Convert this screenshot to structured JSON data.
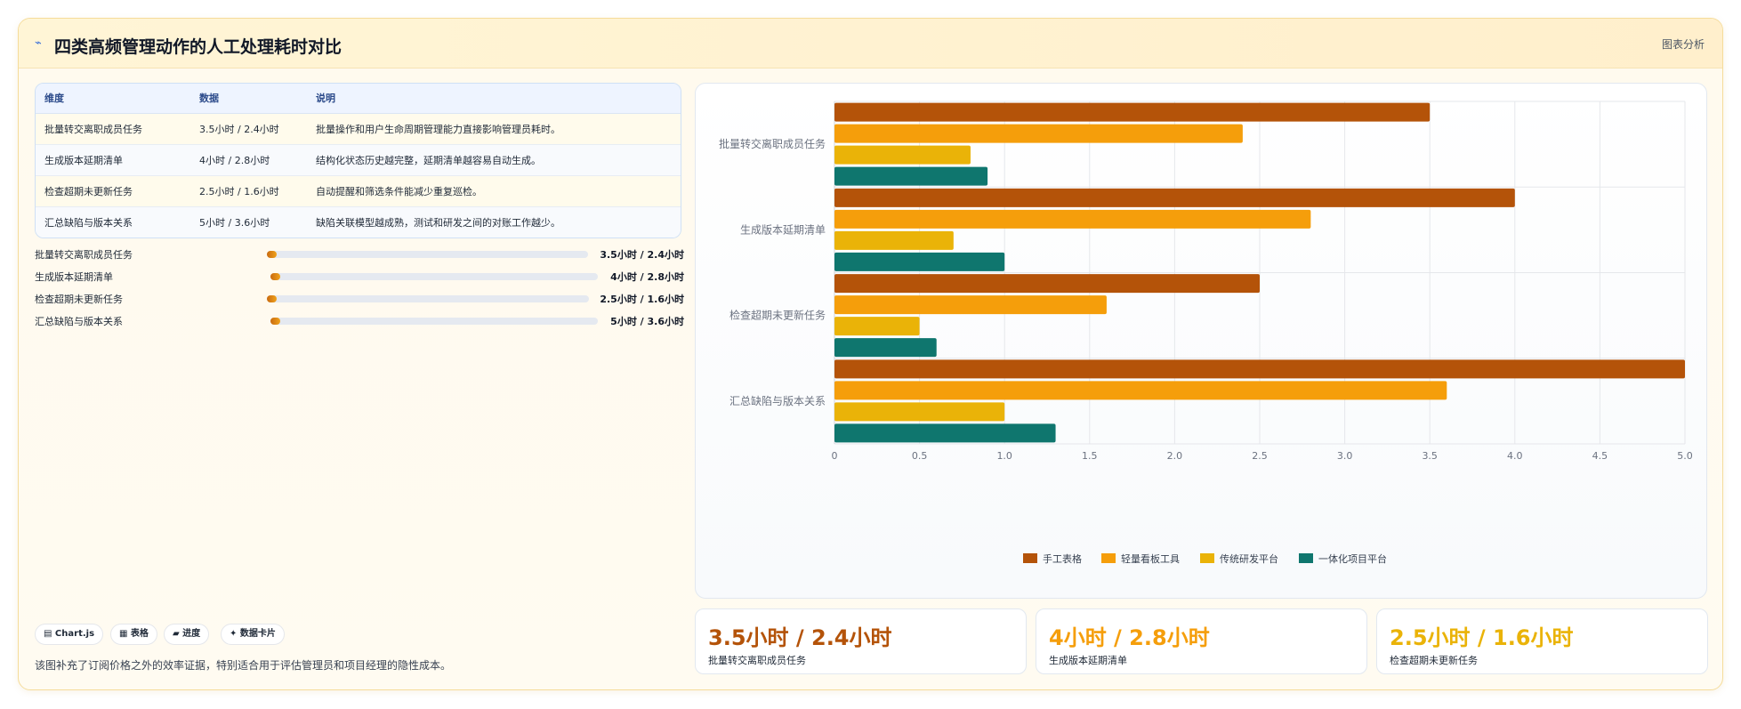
{
  "header": {
    "icon": "chart-line-icon",
    "title": "四类高频管理动作的人工处理耗时对比",
    "right_label": "图表分析"
  },
  "table": {
    "headers": [
      "维度",
      "数据",
      "说明"
    ],
    "rows": [
      {
        "dim": "批量转交离职成员任务",
        "value": "3.5小时 / 2.4小时",
        "desc": "批量操作和用户生命周期管理能力直接影响管理员耗时。"
      },
      {
        "dim": "生成版本延期清单",
        "value": "4小时 / 2.8小时",
        "desc": "结构化状态历史越完整，延期清单越容易自动生成。"
      },
      {
        "dim": "检查超期未更新任务",
        "value": "2.5小时 / 1.6小时",
        "desc": "自动提醒和筛选条件能减少重复巡检。"
      },
      {
        "dim": "汇总缺陷与版本关系",
        "value": "5小时 / 3.6小时",
        "desc": "缺陷关联模型越成熟，测试和研发之间的对账工作越少。"
      }
    ]
  },
  "progress": [
    {
      "label": "批量转交离职成员任务",
      "value_text": "3.5小时 / 2.4小时",
      "fraction": 0.03
    },
    {
      "label": "生成版本延期清单",
      "value_text": "4小时 / 2.8小时",
      "fraction": 0.03
    },
    {
      "label": "检查超期未更新任务",
      "value_text": "2.5小时 / 1.6小时",
      "fraction": 0.03
    },
    {
      "label": "汇总缺陷与版本关系",
      "value_text": "5小时 / 3.6小时",
      "fraction": 0.03
    }
  ],
  "chips": [
    "▤ Chart.js",
    "▦ 表格",
    "▰ 进度",
    "✦ 数据卡片"
  ],
  "footnote": "该图补充了订阅价格之外的效率证据，特别适合用于评估管理员和项目经理的隐性成本。",
  "stats": [
    {
      "value": "3.5小时 / 2.4小时",
      "label": "批量转交离职成员任务",
      "color": "#b45309"
    },
    {
      "value": "4小时 / 2.8小时",
      "label": "生成版本延期清单",
      "color": "#f59e0b"
    },
    {
      "value": "2.5小时 / 1.6小时",
      "label": "检查超期未更新任务",
      "color": "#eab308"
    }
  ],
  "chart_data": {
    "type": "bar",
    "orientation": "horizontal",
    "categories": [
      "批量转交离职成员任务",
      "生成版本延期清单",
      "检查超期未更新任务",
      "汇总缺陷与版本关系"
    ],
    "series": [
      {
        "name": "手工表格",
        "color": "#b45309",
        "values": [
          3.5,
          4.0,
          2.5,
          5.0
        ]
      },
      {
        "name": "轻量看板工具",
        "color": "#f59e0b",
        "values": [
          2.4,
          2.8,
          1.6,
          3.6
        ]
      },
      {
        "name": "传统研发平台",
        "color": "#eab308",
        "values": [
          0.8,
          0.7,
          0.5,
          1.0
        ]
      },
      {
        "name": "一体化项目平台",
        "color": "#0f766e",
        "values": [
          0.9,
          1.0,
          0.6,
          1.3
        ]
      }
    ],
    "xlim": [
      0,
      5
    ],
    "xticks": [
      "0",
      "0.5",
      "1.0",
      "1.5",
      "2.0",
      "2.5",
      "3.0",
      "3.5",
      "4.0",
      "4.5",
      "5.0"
    ],
    "grid": true,
    "legend_position": "bottom"
  }
}
